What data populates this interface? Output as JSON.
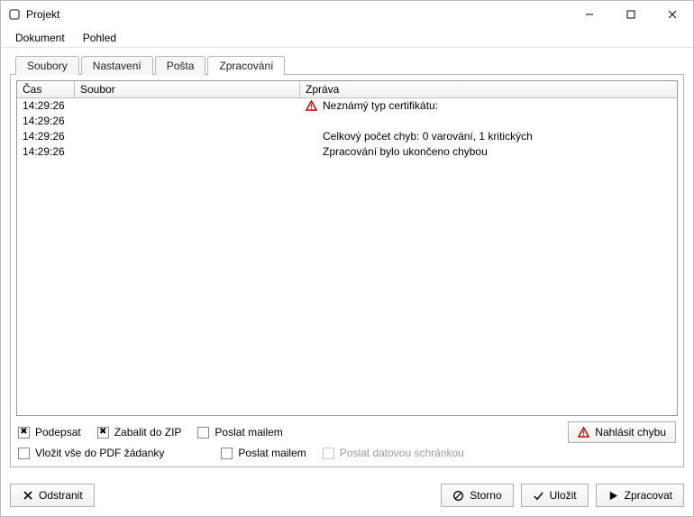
{
  "window": {
    "title": "Projekt"
  },
  "menu": {
    "items": [
      "Dokument",
      "Pohled"
    ]
  },
  "tabs": {
    "items": [
      "Soubory",
      "Nastavení",
      "Pošta",
      "Zpracování"
    ],
    "active_index": 3
  },
  "grid": {
    "headers": {
      "time": "Čas",
      "file": "Soubor",
      "message": "Zpráva"
    },
    "rows": [
      {
        "time": "14:29:26",
        "file": "",
        "has_warn": true,
        "message": "Neznámý typ certifikátu:"
      },
      {
        "time": "14:29:26",
        "file": "",
        "has_warn": false,
        "message": ""
      },
      {
        "time": "14:29:26",
        "file": "",
        "has_warn": false,
        "message": "Celkový počet chyb: 0 varování, 1 kritických"
      },
      {
        "time": "14:29:26",
        "file": "",
        "has_warn": false,
        "message": "Zpracování bylo ukončeno chybou"
      }
    ]
  },
  "options": {
    "podepsat": {
      "label": "Podepsat",
      "checked": true
    },
    "zabalit_zip": {
      "label": "Zabalit do ZIP",
      "checked": true
    },
    "poslat_mailem_1": {
      "label": "Poslat mailem",
      "checked": false
    },
    "vlozit_pdf": {
      "label": "Vložit vše do PDF žádanky",
      "checked": false
    },
    "poslat_mailem_2": {
      "label": "Poslat mailem",
      "checked": false
    },
    "poslat_datovou": {
      "label": "Poslat datovou schránkou",
      "checked": false,
      "disabled": true
    }
  },
  "buttons": {
    "nahlasit_chybu": "Nahlásit chybu",
    "odstranit": "Odstranit",
    "storno": "Storno",
    "ulozit": "Uložit",
    "zpracovat": "Zpracovat"
  },
  "colors": {
    "warn_red": "#d60000"
  }
}
